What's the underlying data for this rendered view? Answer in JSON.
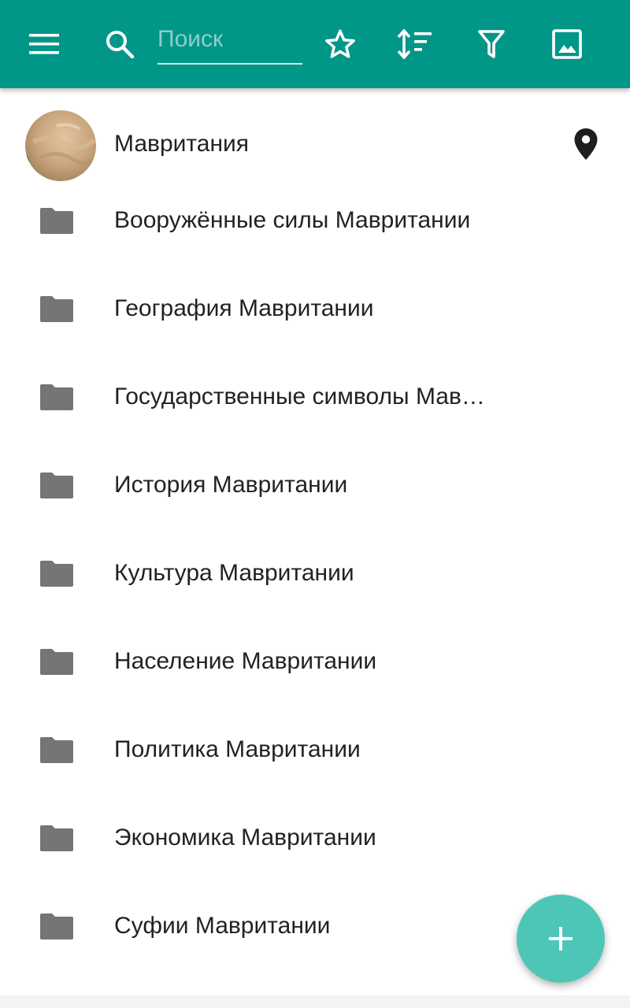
{
  "colors": {
    "toolbar": "#009688",
    "fab": "#4dc6b7",
    "folder_icon": "#757575",
    "text": "#222222"
  },
  "toolbar": {
    "menu_icon": "hamburger-menu-icon",
    "search_icon": "search-icon",
    "search_placeholder": "Поиск",
    "search_value": "",
    "favorite_icon": "star-outline-icon",
    "sort_icon": "sort-icon",
    "filter_icon": "filter-icon",
    "image_icon": "image-icon"
  },
  "header_item": {
    "label": "Мавритания",
    "avatar": "country-thumbnail",
    "location_icon": "map-pin-icon"
  },
  "categories": [
    {
      "label": "Вооружённые силы Мавритании",
      "icon": "folder-icon"
    },
    {
      "label": "География Мавритании",
      "icon": "folder-icon"
    },
    {
      "label": "Государственные символы Мав…",
      "icon": "folder-icon"
    },
    {
      "label": "История Мавритании",
      "icon": "folder-icon"
    },
    {
      "label": "Культура Мавритании",
      "icon": "folder-icon"
    },
    {
      "label": "Население Мавритании",
      "icon": "folder-icon"
    },
    {
      "label": "Политика Мавритании",
      "icon": "folder-icon"
    },
    {
      "label": "Экономика Мавритании",
      "icon": "folder-icon"
    },
    {
      "label": "Суфии Мавритании",
      "icon": "folder-icon"
    }
  ],
  "fab": {
    "icon": "plus-icon"
  }
}
